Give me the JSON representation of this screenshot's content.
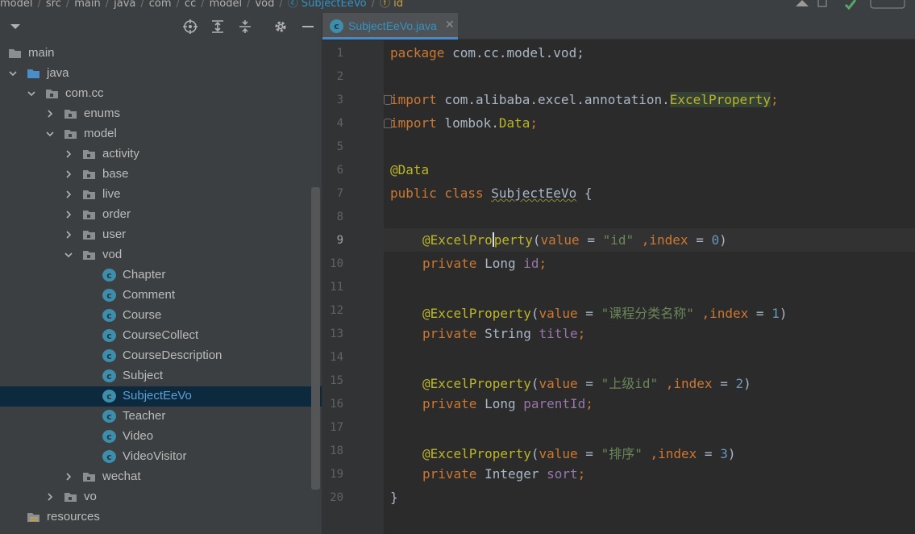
{
  "breadcrumb": {
    "items": [
      "model",
      "src",
      "main",
      "java",
      "com",
      "cc",
      "model",
      "vod"
    ],
    "class_item": "SubjectEeVo",
    "field_item": "id"
  },
  "project_tree": {
    "rows": [
      {
        "label": "main",
        "type": "folder"
      },
      {
        "label": "java",
        "type": "source-folder"
      },
      {
        "label": "com.cc",
        "type": "package"
      },
      {
        "label": "enums",
        "type": "package"
      },
      {
        "label": "model",
        "type": "package"
      },
      {
        "label": "activity",
        "type": "package"
      },
      {
        "label": "base",
        "type": "package"
      },
      {
        "label": "live",
        "type": "package"
      },
      {
        "label": "order",
        "type": "package"
      },
      {
        "label": "user",
        "type": "package"
      },
      {
        "label": "vod",
        "type": "package"
      },
      {
        "label": "Chapter",
        "type": "class"
      },
      {
        "label": "Comment",
        "type": "class"
      },
      {
        "label": "Course",
        "type": "class"
      },
      {
        "label": "CourseCollect",
        "type": "class"
      },
      {
        "label": "CourseDescription",
        "type": "class"
      },
      {
        "label": "Subject",
        "type": "class"
      },
      {
        "label": "SubjectEeVo",
        "type": "class",
        "selected": true
      },
      {
        "label": "Teacher",
        "type": "class"
      },
      {
        "label": "Video",
        "type": "class"
      },
      {
        "label": "VideoVisitor",
        "type": "class"
      },
      {
        "label": "wechat",
        "type": "package"
      },
      {
        "label": "vo",
        "type": "package"
      },
      {
        "label": "resources",
        "type": "resources-folder"
      }
    ]
  },
  "editor": {
    "tab_label": "SubjectEeVo.java",
    "tab_icon": "class-c-icon",
    "line_numbers": [
      "1",
      "2",
      "3",
      "4",
      "5",
      "6",
      "7",
      "8",
      "9",
      "10",
      "11",
      "12",
      "13",
      "14",
      "15",
      "16",
      "17",
      "18",
      "19",
      "20"
    ],
    "current_line": "9",
    "code": {
      "l1_kw": "package",
      "l1_rest": " com.cc.model.vod;",
      "l3_kw": "import",
      "l3_path": " com.alibaba.excel.annotation.",
      "l3_cls": "ExcelProperty",
      "l3_semi": ";",
      "l4_kw": "import",
      "l4_path": " lombok.",
      "l4_cls": "Data",
      "l4_semi": ";",
      "l6": "@Data",
      "l7_kw": "public class",
      "l7_sp": " ",
      "l7_name": "SubjectEeVo",
      "l7_brace": " {",
      "l9_at": "@",
      "l9_a": "ExcelPro",
      "l9_b": "perty",
      "l9_open": "(",
      "l9_value": "value",
      "l9_eq": " = ",
      "l9_str": "\"id\"",
      "l9_comma": " ,",
      "l9_index": "index",
      "l9_eq2": " = ",
      "l9_num": "0",
      "l9_close": ")",
      "l10_kw": "private",
      "l10_type": " Long ",
      "l10_fld": "id",
      "l10_semi": ";",
      "l12_ann": "@ExcelProperty",
      "l12_open": "(",
      "l12_value": "value",
      "l12_eq": " = ",
      "l12_str": "\"课程分类名称\"",
      "l12_comma": " ,",
      "l12_index": "index",
      "l12_eq2": " = ",
      "l12_num": "1",
      "l12_close": ")",
      "l13_kw": "private",
      "l13_type": " String ",
      "l13_fld": "title",
      "l13_semi": ";",
      "l15_ann": "@ExcelProperty",
      "l15_open": "(",
      "l15_value": "value",
      "l15_eq": " = ",
      "l15_str": "\"上级id\"",
      "l15_comma": " ,",
      "l15_index": "index",
      "l15_eq2": " = ",
      "l15_num": "2",
      "l15_close": ")",
      "l16_kw": "private",
      "l16_type": " Long ",
      "l16_fld": "parentId",
      "l16_semi": ";",
      "l18_ann": "@ExcelProperty",
      "l18_open": "(",
      "l18_value": "value",
      "l18_eq": " = ",
      "l18_str": "\"排序\"",
      "l18_comma": " ,",
      "l18_index": "index",
      "l18_eq2": " = ",
      "l18_num": "3",
      "l18_close": ")",
      "l19_kw": "private",
      "l19_type": " Integer ",
      "l19_fld": "sort",
      "l19_semi": ";",
      "l20": "}"
    }
  },
  "colors": {
    "accent": "#4a88c7",
    "selection": "#0d293e",
    "keyword": "#cc7832",
    "annotation": "#bbb529",
    "string": "#6a8759",
    "number": "#6897bb",
    "field": "#9876aa"
  }
}
